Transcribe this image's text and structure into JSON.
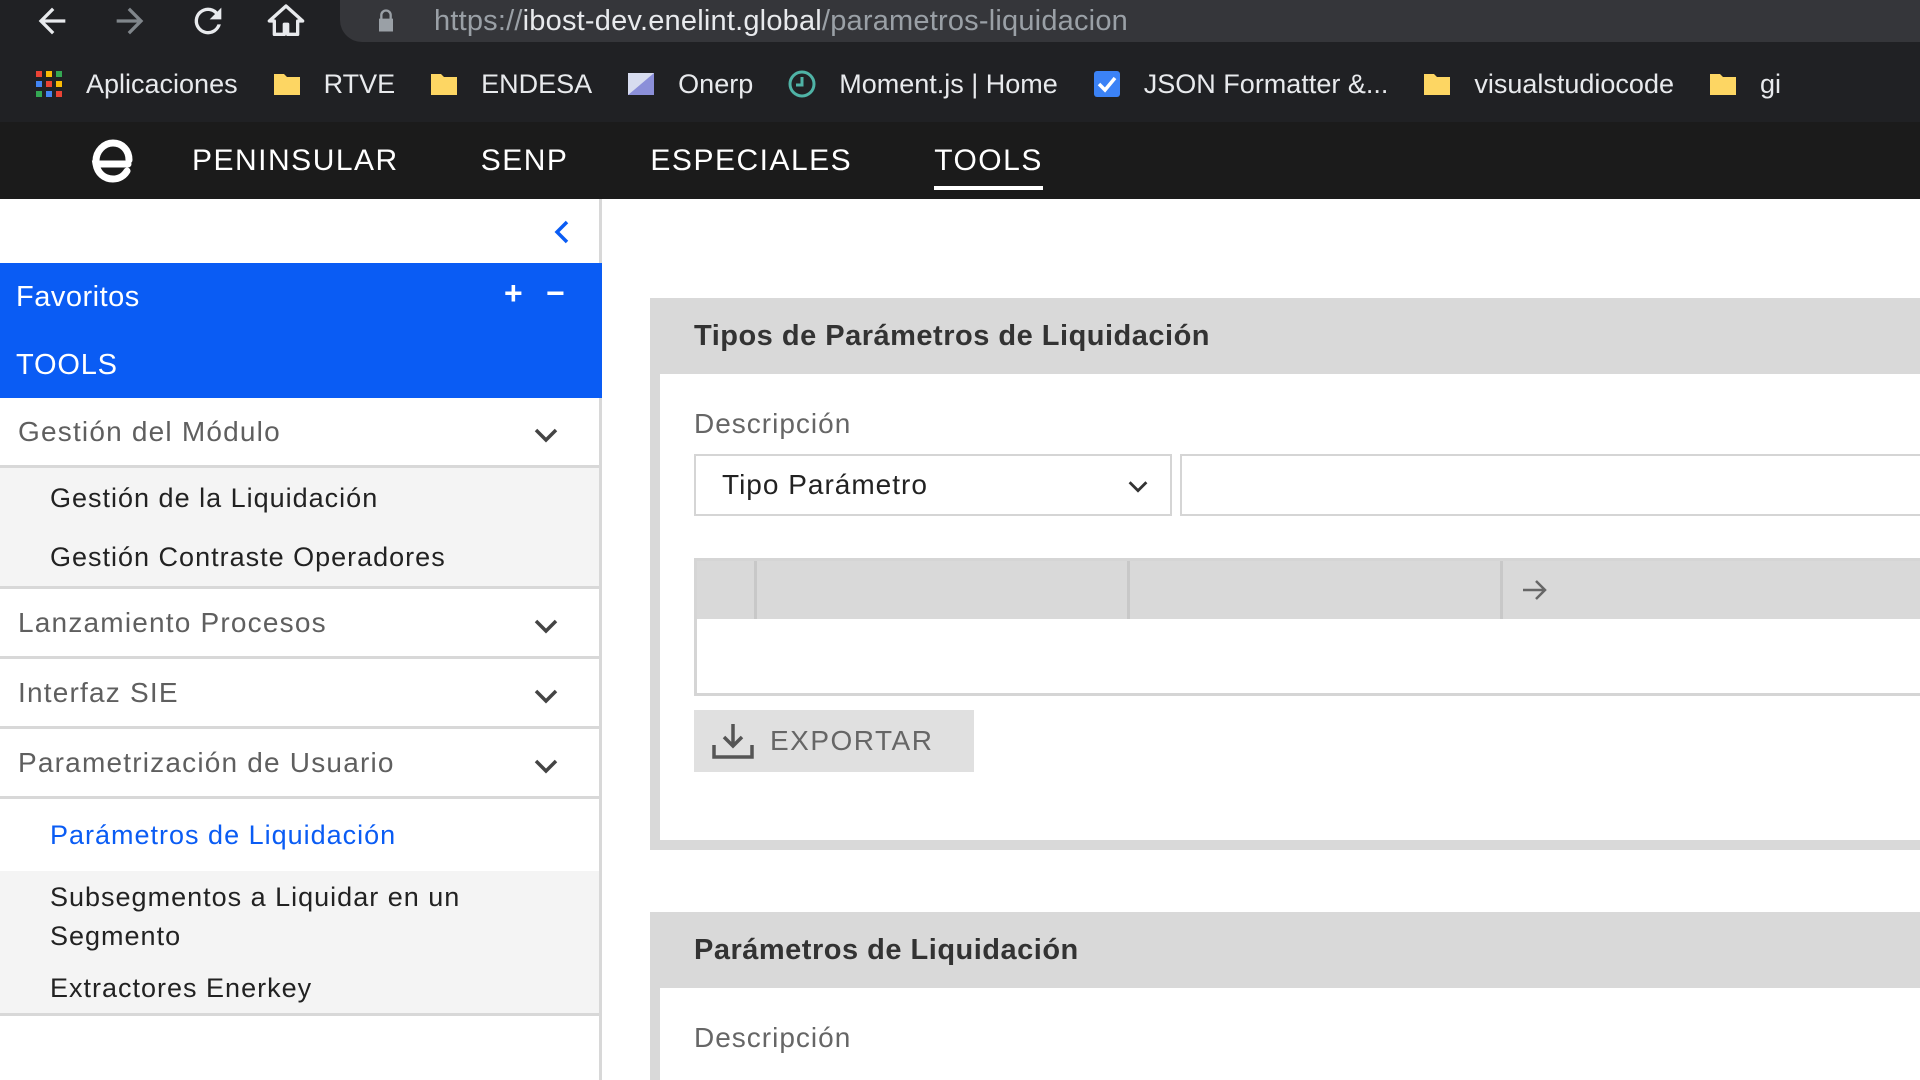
{
  "browser": {
    "url_prefix": "https://",
    "url_host": "ibost-dev.enelint.global",
    "url_path": "/parametros-liquidacion",
    "bookmarks": [
      {
        "label": "Aplicaciones",
        "icon": "apps-grid-icon"
      },
      {
        "label": "RTVE",
        "icon": "folder-icon"
      },
      {
        "label": "ENDESA",
        "icon": "folder-icon"
      },
      {
        "label": "Onerp",
        "icon": "onerp-icon"
      },
      {
        "label": "Moment.js | Home",
        "icon": "clock-icon"
      },
      {
        "label": "JSON Formatter &...",
        "icon": "check-icon"
      },
      {
        "label": "visualstudiocode",
        "icon": "folder-icon"
      },
      {
        "label": "gi",
        "icon": "folder-icon"
      }
    ]
  },
  "header": {
    "tabs": [
      {
        "label": "PENINSULAR",
        "active": false
      },
      {
        "label": "SENP",
        "active": false
      },
      {
        "label": "ESPECIALES",
        "active": false
      },
      {
        "label": "TOOLS",
        "active": true
      }
    ]
  },
  "sidebar": {
    "favorites_title": "Favoritos",
    "favorites_add": "+",
    "favorites_remove": "−",
    "favorites_item": "TOOLS",
    "groups": [
      {
        "label": "Gestión del Módulo",
        "items": [
          "Gestión de la Liquidación",
          "Gestión Contraste Operadores"
        ]
      },
      {
        "label": "Lanzamiento Procesos"
      },
      {
        "label": "Interfaz SIE"
      },
      {
        "label": "Parametrización de Usuario",
        "items": [
          "Parámetros de Liquidación",
          "Subsegmentos a Liquidar en un Segmento",
          "Extractores Enerkey"
        ],
        "active_item": "Parámetros de Liquidación"
      }
    ]
  },
  "main": {
    "panel1": {
      "title": "Tipos de Parámetros de Liquidación",
      "field_label": "Descripción",
      "select_value": "Tipo Parámetro",
      "input_value": "",
      "export_label": "EXPORTAR"
    },
    "panel2": {
      "title": "Parámetros de Liquidación",
      "field_label": "Descripción"
    }
  },
  "colors": {
    "accent": "#0a5cf4",
    "header_bg": "#1b1b1b",
    "browser_bg": "#202124",
    "panel_bg": "#d9d9d9"
  }
}
